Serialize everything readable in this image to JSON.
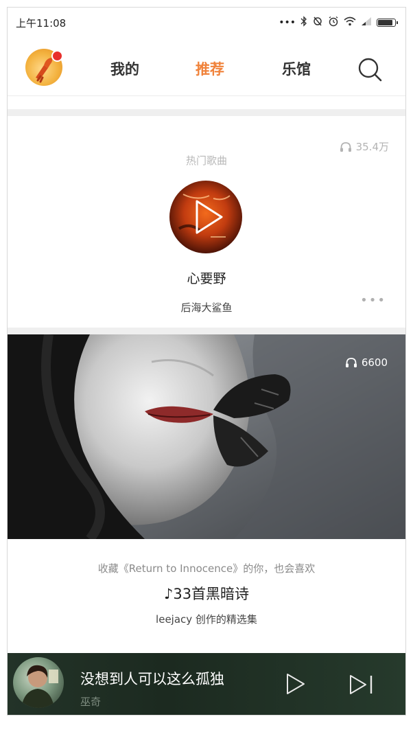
{
  "status_bar": {
    "time": "上午11:08",
    "icons": [
      "dots-icon",
      "bluetooth-icon",
      "sync-icon",
      "alarm-icon",
      "wifi-icon",
      "signal-icon",
      "battery-icon"
    ],
    "battery_level": 0.8
  },
  "nav": {
    "tabs": [
      {
        "label": "我的"
      },
      {
        "label": "推荐"
      },
      {
        "label": "乐馆"
      }
    ],
    "active_tab": "推荐",
    "accent_color": "#f0823a"
  },
  "hot_song": {
    "play_count": "35.4万",
    "section_label": "热门歌曲",
    "title": "心要野",
    "artist": "后海大鲨鱼",
    "more_label": "•••"
  },
  "playlist": {
    "play_count": "6600",
    "subtitle": "收藏《Return to Innocence》的你，也会喜欢",
    "title": "♪33首黑暗诗",
    "creator": "leejacy 创作的精选集"
  },
  "now_playing": {
    "title": "没想到人可以这么孤独",
    "artist": "巫奇"
  }
}
